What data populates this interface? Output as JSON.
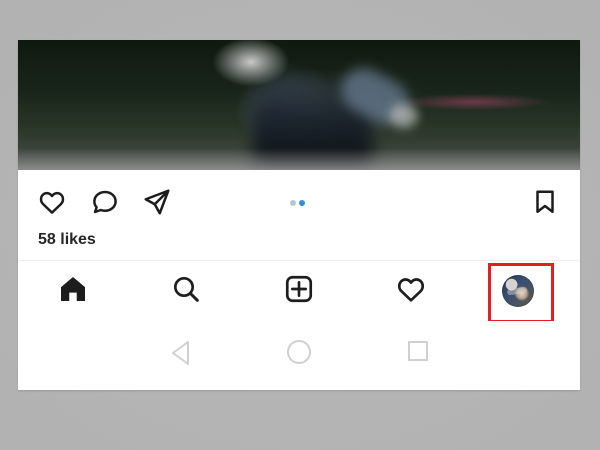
{
  "post": {
    "likes": "58 likes"
  },
  "actions": {
    "like_icon": "heart-outline-icon",
    "comment_icon": "comment-bubble-icon",
    "share_icon": "paper-plane-icon",
    "save_icon": "bookmark-icon",
    "carousel_dots": 2,
    "active_dot_index": 1
  },
  "bottom_nav": {
    "items": [
      {
        "icon": "home-icon"
      },
      {
        "icon": "search-icon"
      },
      {
        "icon": "add-post-icon"
      },
      {
        "icon": "heart-outline-icon"
      },
      {
        "icon": "profile-avatar-icon"
      }
    ]
  },
  "system_nav": {
    "items": [
      {
        "icon": "back-triangle-icon"
      },
      {
        "icon": "home-circle-icon"
      },
      {
        "icon": "recent-apps-square-icon"
      }
    ]
  },
  "colors": {
    "highlight": "#e31e24",
    "active_dot": "#2e8fe0",
    "inactive_dot": "#b7c7d8",
    "text": "#262626"
  }
}
